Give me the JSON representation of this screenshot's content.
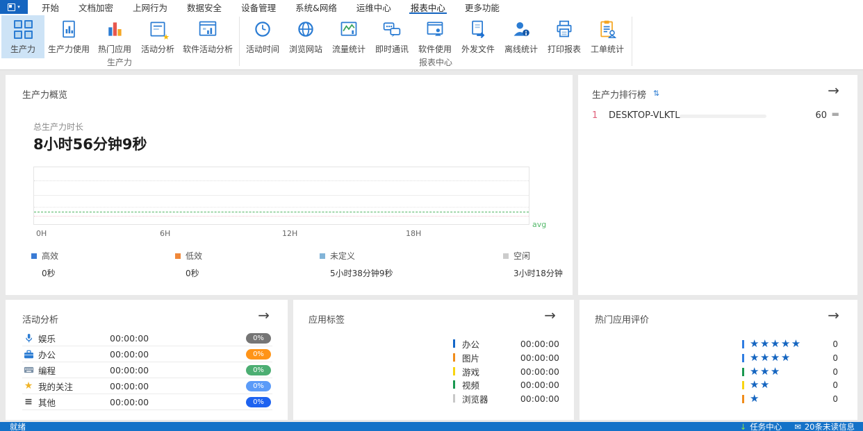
{
  "icons": {
    "arrow": "→",
    "sort": "⇅",
    "caret": "▾",
    "download": "↓",
    "envelope": "✉",
    "star_accent": "★",
    "list": "≡",
    "focus_star": "★"
  },
  "menu": {
    "items": [
      {
        "label": "开始"
      },
      {
        "label": "文档加密"
      },
      {
        "label": "上网行为"
      },
      {
        "label": "数据安全"
      },
      {
        "label": "设备管理"
      },
      {
        "label": "系统&网络"
      },
      {
        "label": "运维中心"
      },
      {
        "label": "报表中心",
        "active": true
      },
      {
        "label": "更多功能"
      }
    ]
  },
  "ribbon": {
    "groups": [
      {
        "label": "生产力",
        "buttons": [
          {
            "label": "生产力",
            "selected": true
          },
          {
            "label": "生产力使用"
          },
          {
            "label": "热门应用"
          },
          {
            "label": "活动分析"
          },
          {
            "label": "软件活动分析"
          }
        ]
      },
      {
        "label": "报表中心",
        "buttons": [
          {
            "label": "活动时间"
          },
          {
            "label": "浏览网站"
          },
          {
            "label": "流量统计"
          },
          {
            "label": "即时通讯"
          },
          {
            "label": "软件使用"
          },
          {
            "label": "外发文件"
          },
          {
            "label": "离线统计"
          },
          {
            "label": "打印报表"
          },
          {
            "label": "工单统计"
          }
        ]
      }
    ]
  },
  "overview": {
    "title": "生产力概览",
    "total_label": "总生产力时长",
    "total_value": "8小时56分钟9秒",
    "chart_data": {
      "type": "area",
      "x_ticks": [
        "0H",
        "6H",
        "12H",
        "18H"
      ],
      "x_range_hours": [
        0,
        24
      ],
      "series": [],
      "avg_line_label": "avg",
      "avg_line_color": "#4db35f",
      "grid": true
    },
    "legend": [
      {
        "name": "高效",
        "value": "0秒",
        "color": "#3a7bd5"
      },
      {
        "name": "低效",
        "value": "0秒",
        "color": "#f0883a"
      },
      {
        "name": "未定义",
        "value": "5小时38分钟9秒",
        "color": "#82b4d8"
      },
      {
        "name": "空闲",
        "value": "3小时18分钟",
        "color": "#cccccc"
      }
    ]
  },
  "ranking": {
    "title": "生产力排行榜",
    "rows": [
      {
        "rank": "1",
        "name": "DESKTOP-VLKTL...",
        "score": "60",
        "progress_width": "60%",
        "trend": "▬"
      }
    ]
  },
  "activity": {
    "title": "活动分析",
    "rows": [
      {
        "name": "娱乐",
        "time": "00:00:00",
        "percent": "0%",
        "badge_color": "#757575"
      },
      {
        "name": "办公",
        "time": "00:00:00",
        "percent": "0%",
        "badge_color": "#ff9418"
      },
      {
        "name": "编程",
        "time": "00:00:00",
        "percent": "0%",
        "badge_color": "#4cae72"
      },
      {
        "name": "我的关注",
        "time": "00:00:00",
        "percent": "0%",
        "badge_color": "#5b9bf8"
      },
      {
        "name": "其他",
        "time": "00:00:00",
        "percent": "0%",
        "badge_color": "#1d62f0"
      }
    ]
  },
  "tags": {
    "title": "应用标签",
    "rows": [
      {
        "name": "办公",
        "time": "00:00:00",
        "color": "#1467c8"
      },
      {
        "name": "图片",
        "time": "00:00:00",
        "color": "#f08c1b"
      },
      {
        "name": "游戏",
        "time": "00:00:00",
        "color": "#f8d411"
      },
      {
        "name": "视频",
        "time": "00:00:00",
        "color": "#1a9850"
      },
      {
        "name": "浏览器",
        "time": "00:00:00",
        "color": "#c8c8c8"
      }
    ]
  },
  "rating": {
    "title": "热门应用评价",
    "rows": [
      {
        "stars": "★★★★★",
        "count": "0",
        "color": "#2f7de1"
      },
      {
        "stars": "★★★★",
        "count": "0",
        "color": "#2f7de1"
      },
      {
        "stars": "★★★",
        "count": "0",
        "color": "#1a9850"
      },
      {
        "stars": "★★",
        "count": "0",
        "color": "#f8d411"
      },
      {
        "stars": "★",
        "count": "0",
        "color": "#f08c1b"
      }
    ]
  },
  "statusbar": {
    "ready": "就绪",
    "task_center": "任务中心",
    "unread": "20条未读信息"
  }
}
